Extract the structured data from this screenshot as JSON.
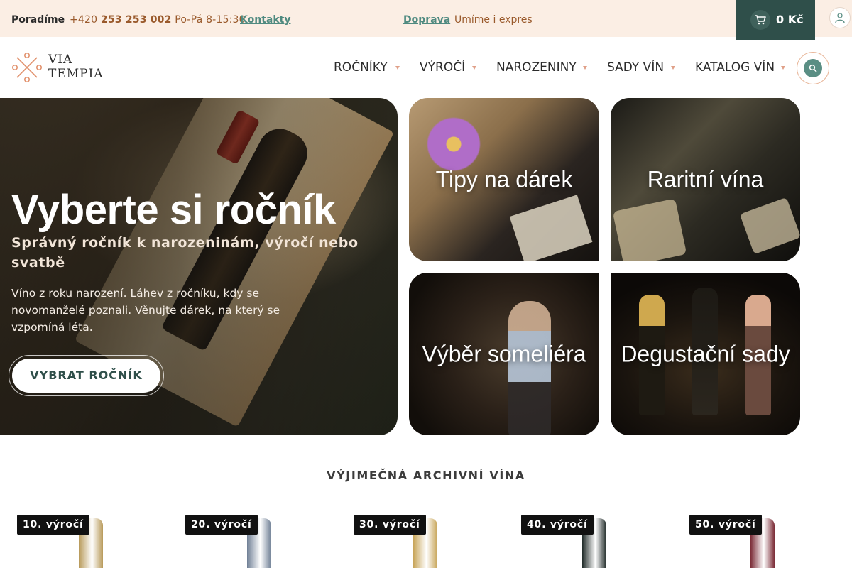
{
  "topbar": {
    "advice_label": "Poradíme",
    "phone_prefix": "+420",
    "phone_number": "253 253 002",
    "hours": "Po-Pá 8-15:30",
    "contacts_link": "Kontakty",
    "shipping_link": "Doprava",
    "shipping_note": "Umíme i expres"
  },
  "cart": {
    "value": "0 Kč",
    "icon": "cart-icon"
  },
  "user": {
    "icon": "user-icon"
  },
  "logo": {
    "line1": "VIA",
    "line2": "TEMPIA"
  },
  "nav": {
    "items": [
      {
        "label": "ROČNÍKY"
      },
      {
        "label": "VÝROČÍ"
      },
      {
        "label": "NAROZENINY"
      },
      {
        "label": "SADY VÍN"
      },
      {
        "label": "KATALOG VÍN"
      }
    ],
    "search_icon": "search-icon"
  },
  "hero": {
    "title": "Vyberte si ročník",
    "subtitle": "Správný ročník k narozeninám, výročí nebo svatbě",
    "text": "Víno z roku narození. Láhev z ročníku, kdy se novomanželé poznali. Věnujte dárek, na který se vzpomíná léta.",
    "cta": "VYBRAT ROČNÍK"
  },
  "tiles": [
    {
      "label": "Tipy na dárek"
    },
    {
      "label": "Raritní vína"
    },
    {
      "label": "Výběr someliéra"
    },
    {
      "label": "Degustační sady"
    }
  ],
  "section": {
    "title": "VÝJIMEČNÁ ARCHIVNÍ VÍNA",
    "products": [
      {
        "badge": "10. výročí",
        "capsule_color": "#b89a5a"
      },
      {
        "badge": "20. výročí",
        "capsule_color": "#6f7f95"
      },
      {
        "badge": "30. výročí",
        "capsule_color": "#c7a457"
      },
      {
        "badge": "40. výročí",
        "capsule_color": "#1f2a28"
      },
      {
        "badge": "50. výročí",
        "capsule_color": "#7a2a35"
      }
    ]
  },
  "colors": {
    "topbar_bg": "#fbeee4",
    "accent_green": "#2f4f4a",
    "link_green": "#4f8a80",
    "accent_brown": "#9a5a2c"
  }
}
